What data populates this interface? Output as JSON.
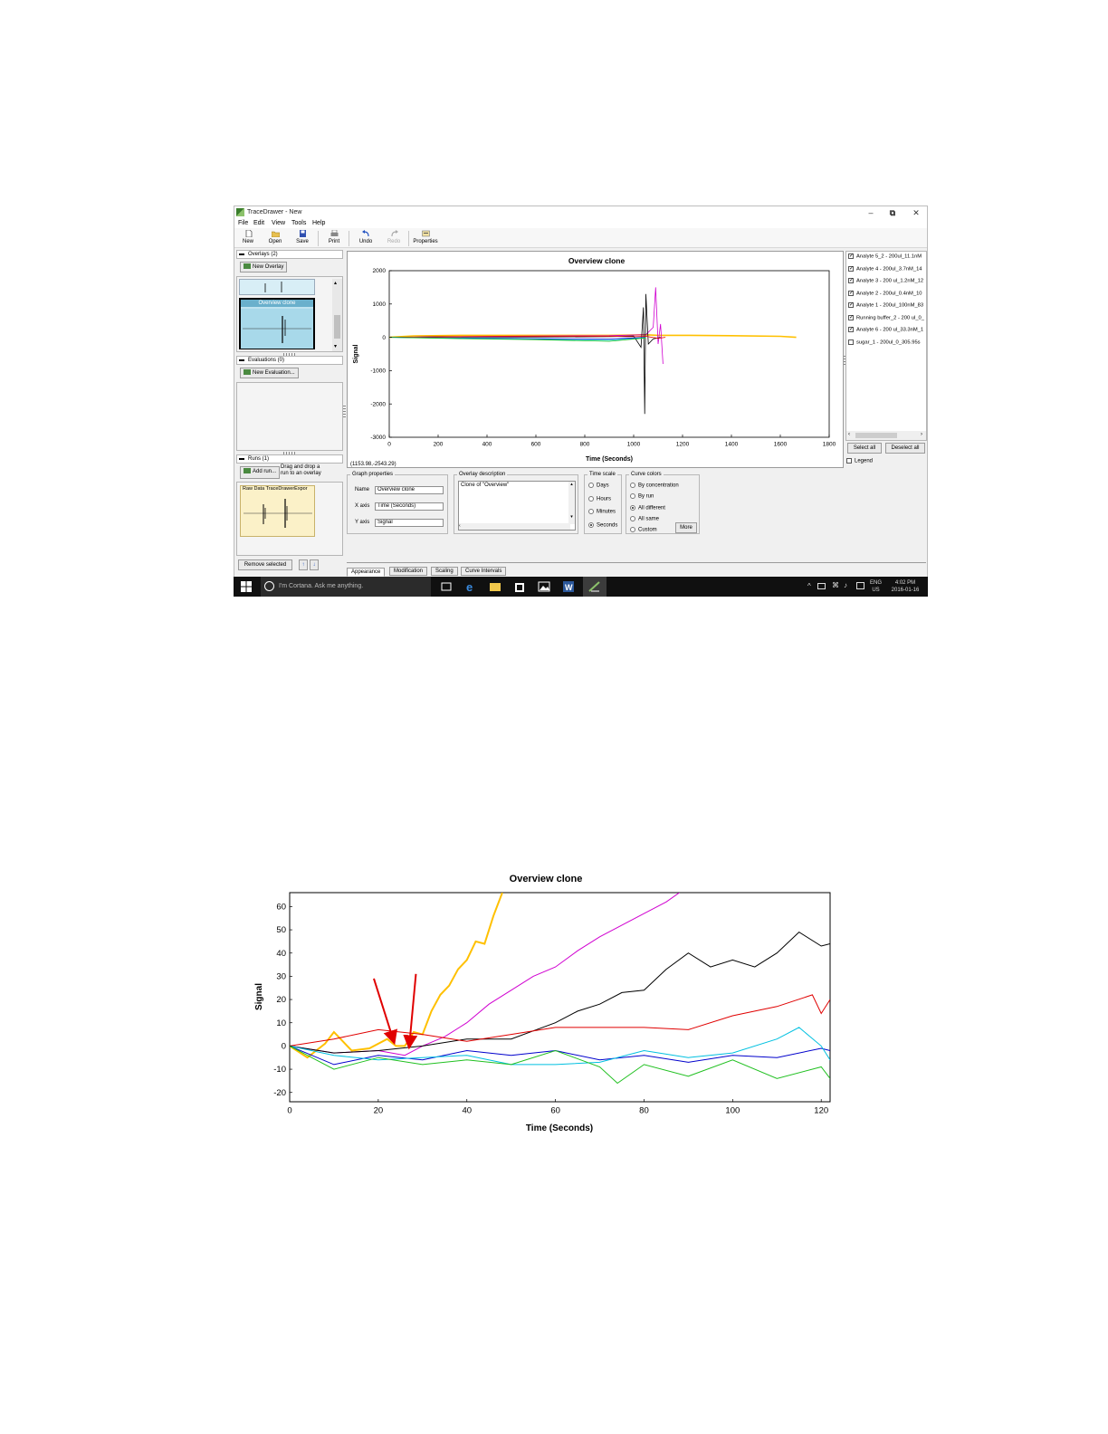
{
  "window": {
    "title": "TraceDrawer - New",
    "controls": {
      "minimize": "–",
      "restore": "⧉",
      "close": "✕"
    }
  },
  "menu": [
    "File",
    "Edit",
    "View",
    "Tools",
    "Help"
  ],
  "toolbar": {
    "new": "New",
    "open": "Open",
    "save": "Save",
    "print": "Print",
    "undo": "Undo",
    "redo": "Redo",
    "properties": "Properties"
  },
  "left_panel": {
    "overlays_header": "Overlays (2)",
    "new_overlay_button": "New Overlay",
    "overlay_selected_label": "Overview clone",
    "evaluations_header": "Evaluations (0)",
    "new_evaluation_button": "New Evaluation...",
    "runs_header": "Runs (1)",
    "add_run_button": "Add run...",
    "add_run_hint_line1": "Drag and drop a",
    "add_run_hint_line2": "run to an overlay",
    "run_thumb_label": "Raw Data TraceDrawerExpor",
    "remove_selected_button": "Remove selected"
  },
  "main_chart": {
    "title": "Overview clone",
    "xlabel": "Time (Seconds)",
    "ylabel": "Signal",
    "cursor_readout": "(1153.98,-2543.29)",
    "xticks": [
      "0",
      "200",
      "400",
      "600",
      "800",
      "1000",
      "1200",
      "1400",
      "1600",
      "1800"
    ],
    "yticks": [
      "2000",
      "1000",
      "0",
      "-1000",
      "-2000",
      "-3000"
    ]
  },
  "curves_list": {
    "items": [
      {
        "label": "Analyte 5_2 - 200ul_11.1nM",
        "checked": true
      },
      {
        "label": "Analyte 4 - 200ul_3.7nM_14",
        "checked": true
      },
      {
        "label": "Analyte 3 - 200 ul_1.2nM_12",
        "checked": true
      },
      {
        "label": "Analyte 2 - 200ul_0.4nM_10",
        "checked": true
      },
      {
        "label": "Analyte 1 - 200ul_100nM_83",
        "checked": true
      },
      {
        "label": "Running buffer_2 - 200 ul_0_",
        "checked": true
      },
      {
        "label": "Analyte 6 - 200 ul_33.3nM_1",
        "checked": true
      },
      {
        "label": "sugar_1 - 200ul_0_305.95s",
        "checked": false
      }
    ],
    "select_all_button": "Select all",
    "deselect_all_button": "Deselect all",
    "legend_checkbox": "Legend"
  },
  "graph_properties": {
    "group_title": "Graph properties",
    "name_label": "Name",
    "name_value": "Overview clone",
    "xaxis_label": "X axis",
    "xaxis_value": "Time (Seconds)",
    "yaxis_label": "Y axis",
    "yaxis_value": "Signal"
  },
  "overlay_description": {
    "group_title": "Overlay description",
    "text": "Clone of \"Overview\""
  },
  "time_scale": {
    "group_title": "Time scale",
    "options": [
      "Days",
      "Hours",
      "Minutes",
      "Seconds"
    ],
    "selected": "Seconds"
  },
  "curve_colors": {
    "group_title": "Curve colors",
    "options": [
      "By concentration",
      "By run",
      "All different",
      "All same",
      "Custom"
    ],
    "selected": "All different",
    "more_button": "More"
  },
  "tabs": [
    "Appearance",
    "Modification",
    "Scaling",
    "Curve Intervals"
  ],
  "active_tab": "Appearance",
  "taskbar": {
    "search_placeholder": "I'm Cortana. Ask me anything.",
    "lang_line1": "ENG",
    "lang_line2": "US",
    "time": "4:02 PM",
    "date": "2016-01-16"
  },
  "chart_data": [
    {
      "type": "line",
      "title": "Overview clone",
      "xlabel": "Time (Seconds)",
      "ylabel": "Signal",
      "xlim": [
        0,
        1800
      ],
      "ylim": [
        -3000,
        2000
      ],
      "series": [
        {
          "color": "#ffc000",
          "x": [
            0,
            100,
            300,
            600,
            900,
            1000,
            1040,
            1100,
            1200,
            1400,
            1600,
            1665
          ],
          "y": [
            0,
            40,
            60,
            60,
            60,
            70,
            80,
            60,
            60,
            50,
            30,
            0
          ]
        },
        {
          "color": "#d000d0",
          "x": [
            0,
            200,
            400,
            600,
            900,
            1050,
            1080,
            1090,
            1100,
            1110,
            1120
          ],
          "y": [
            0,
            20,
            30,
            40,
            50,
            80,
            300,
            1500,
            -200,
            400,
            -800
          ]
        },
        {
          "color": "#000000",
          "x": [
            0,
            200,
            400,
            600,
            900,
            1000,
            1030,
            1040,
            1045,
            1050,
            1060,
            1080,
            1110
          ],
          "y": [
            0,
            10,
            10,
            10,
            20,
            40,
            -300,
            900,
            -2300,
            1300,
            -200,
            -50,
            0
          ]
        },
        {
          "color": "#e00000",
          "x": [
            0,
            300,
            600,
            900,
            1000,
            1050,
            1100,
            1130
          ],
          "y": [
            0,
            20,
            30,
            30,
            20,
            30,
            -30,
            0
          ]
        },
        {
          "color": "#0000cc",
          "x": [
            0,
            300,
            600,
            900,
            1000,
            1050
          ],
          "y": [
            0,
            -20,
            -40,
            -50,
            -20,
            0
          ]
        },
        {
          "color": "#00c0e0",
          "x": [
            0,
            300,
            600,
            900,
            1050
          ],
          "y": [
            0,
            -30,
            -60,
            -90,
            -10
          ]
        },
        {
          "color": "#20c020",
          "x": [
            0,
            300,
            600,
            900,
            1050
          ],
          "y": [
            0,
            -40,
            -70,
            -120,
            -20
          ]
        }
      ]
    },
    {
      "type": "line",
      "title": "Overview clone",
      "xlabel": "Time (Seconds)",
      "ylabel": "Signal",
      "xlim": [
        0,
        122
      ],
      "ylim": [
        -24,
        66
      ],
      "annotations": [
        {
          "type": "arrow",
          "color": "#e00000",
          "from": [
            19,
            29
          ],
          "to": [
            23.5,
            2
          ]
        },
        {
          "type": "arrow",
          "color": "#e00000",
          "from": [
            28.5,
            31
          ],
          "to": [
            27,
            0
          ]
        }
      ],
      "series": [
        {
          "color": "#ffc000",
          "x": [
            0,
            4,
            8,
            10,
            14,
            18,
            22,
            24,
            26,
            28,
            30,
            32,
            34,
            36,
            38,
            40,
            42,
            44,
            46,
            48
          ],
          "y": [
            0,
            -5,
            1,
            6,
            -2,
            -1,
            3,
            0,
            0,
            6,
            5,
            15,
            22,
            26,
            33,
            37,
            45,
            44,
            56,
            66
          ]
        },
        {
          "color": "#d000d0",
          "x": [
            0,
            10,
            20,
            26,
            30,
            35,
            40,
            45,
            50,
            55,
            60,
            65,
            70,
            75,
            80,
            85,
            88
          ],
          "y": [
            0,
            -3,
            -2,
            -4,
            0,
            4,
            10,
            18,
            24,
            30,
            34,
            41,
            47,
            52,
            57,
            62,
            66
          ]
        },
        {
          "color": "#000000",
          "x": [
            0,
            10,
            20,
            30,
            40,
            50,
            60,
            65,
            70,
            75,
            80,
            85,
            90,
            95,
            100,
            105,
            110,
            115,
            120,
            122
          ],
          "y": [
            0,
            -3,
            -2,
            0,
            3,
            3,
            10,
            15,
            18,
            23,
            24,
            33,
            40,
            34,
            37,
            34,
            40,
            49,
            43,
            44
          ]
        },
        {
          "color": "#e00000",
          "x": [
            0,
            10,
            20,
            30,
            40,
            50,
            60,
            70,
            80,
            90,
            100,
            110,
            118,
            120,
            122
          ],
          "y": [
            0,
            3,
            7,
            5,
            2,
            5,
            8,
            8,
            8,
            7,
            13,
            17,
            22,
            14,
            20
          ]
        },
        {
          "color": "#0000cc",
          "x": [
            0,
            10,
            20,
            30,
            40,
            50,
            60,
            70,
            80,
            90,
            100,
            110,
            120,
            122
          ],
          "y": [
            0,
            -8,
            -4,
            -6,
            -2,
            -4,
            -2,
            -6,
            -4,
            -7,
            -4,
            -5,
            -1,
            -2
          ]
        },
        {
          "color": "#00c0e0",
          "x": [
            0,
            10,
            20,
            30,
            40,
            50,
            60,
            70,
            80,
            90,
            100,
            110,
            115,
            120,
            122
          ],
          "y": [
            0,
            -4,
            -6,
            -5,
            -4,
            -8,
            -8,
            -7,
            -2,
            -5,
            -3,
            3,
            8,
            0,
            -6
          ]
        },
        {
          "color": "#20c020",
          "x": [
            0,
            10,
            20,
            30,
            40,
            50,
            60,
            70,
            74,
            80,
            90,
            100,
            110,
            120,
            122
          ],
          "y": [
            0,
            -10,
            -5,
            -8,
            -6,
            -8,
            -2,
            -9,
            -16,
            -8,
            -13,
            -6,
            -14,
            -9,
            -14
          ]
        }
      ]
    }
  ]
}
